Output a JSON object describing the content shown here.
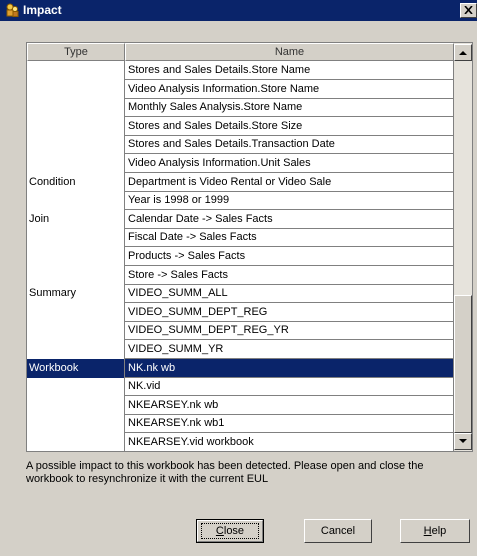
{
  "window": {
    "title": "Impact",
    "close_glyph": "×"
  },
  "grid": {
    "headers": {
      "type": "Type",
      "name": "Name"
    },
    "rows": [
      {
        "type": "",
        "name": "Stores and Sales Details.Store Name"
      },
      {
        "type": "",
        "name": "Video Analysis Information.Store Name"
      },
      {
        "type": "",
        "name": "Monthly Sales Analysis.Store Name"
      },
      {
        "type": "",
        "name": "Stores and Sales Details.Store Size"
      },
      {
        "type": "",
        "name": "Stores and Sales Details.Transaction Date"
      },
      {
        "type": "",
        "name": "Video Analysis Information.Unit Sales"
      },
      {
        "type": "Condition",
        "name": "Department is Video Rental or Video Sale"
      },
      {
        "type": "",
        "name": "Year is 1998 or 1999"
      },
      {
        "type": "Join",
        "name": "Calendar Date -> Sales Facts"
      },
      {
        "type": "",
        "name": "Fiscal Date -> Sales Facts"
      },
      {
        "type": "",
        "name": "Products -> Sales Facts"
      },
      {
        "type": "",
        "name": "Store -> Sales Facts"
      },
      {
        "type": "Summary",
        "name": "VIDEO_SUMM_ALL"
      },
      {
        "type": "",
        "name": "VIDEO_SUMM_DEPT_REG"
      },
      {
        "type": "",
        "name": "VIDEO_SUMM_DEPT_REG_YR"
      },
      {
        "type": "",
        "name": "VIDEO_SUMM_YR"
      },
      {
        "type": "Workbook",
        "name": "NK.nk wb",
        "selected": true
      },
      {
        "type": "",
        "name": "NK.vid"
      },
      {
        "type": "",
        "name": "NKEARSEY.nk wb"
      },
      {
        "type": "",
        "name": "NKEARSEY.nk wb1"
      },
      {
        "type": "",
        "name": "NKEARSEY.vid workbook"
      }
    ]
  },
  "message": "A possible impact to this workbook has been detected. Please open and close the workbook to resynchronize it with the current EUL",
  "buttons": {
    "close": {
      "mnemonic": "C",
      "rest": "lose"
    },
    "cancel": {
      "label": "Cancel"
    },
    "help": {
      "mnemonic": "H",
      "rest": "elp"
    }
  },
  "colors": {
    "titlebar": "#0a246a",
    "selection": "#0a246a",
    "face": "#d4d0c8"
  }
}
